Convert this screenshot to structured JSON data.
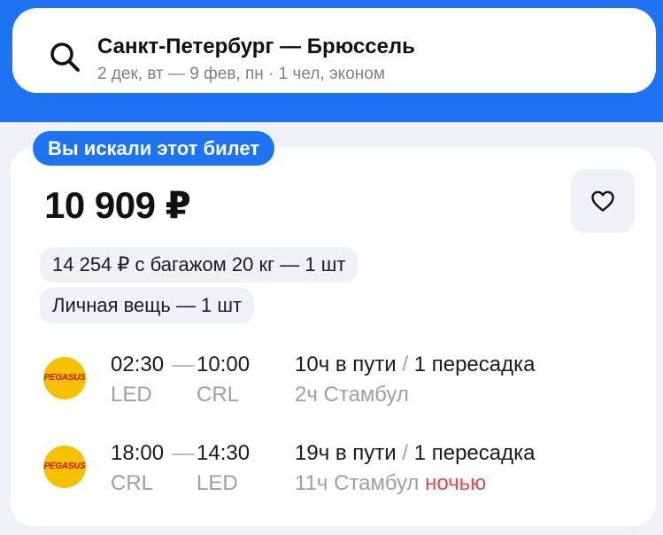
{
  "colors": {
    "accent": "#1e73f0",
    "night": "#e5484d",
    "airline_logo": "#f5c000"
  },
  "search": {
    "icon": "search-icon",
    "route": "Санкт-Петербург — Брюссель",
    "params": "2 дек, вт — 9 фев, пн · 1 чел, эконом"
  },
  "ticket": {
    "badge": "Вы искали этот билет",
    "price": "10 909 ₽",
    "favorite_icon": "heart-icon",
    "baggage_option": "14 254 ₽ с багажом 20 кг — 1 шт",
    "personal_item": "Личная вещь — 1 шт",
    "segments": [
      {
        "airline_logo": "PEGASUS",
        "dep_time": "02:30",
        "arr_time": "10:00",
        "dep_airport": "LED",
        "arr_airport": "CRL",
        "duration": "10ч в пути",
        "separator": "/",
        "stops": "1 пересадка",
        "transfer": "2ч Стамбул",
        "transfer_note": ""
      },
      {
        "airline_logo": "PEGASUS",
        "dep_time": "18:00",
        "arr_time": "14:30",
        "dep_airport": "CRL",
        "arr_airport": "LED",
        "duration": "19ч в пути",
        "separator": "/",
        "stops": "1 пересадка",
        "transfer": "11ч Стамбул",
        "transfer_note": "ночью"
      }
    ]
  }
}
